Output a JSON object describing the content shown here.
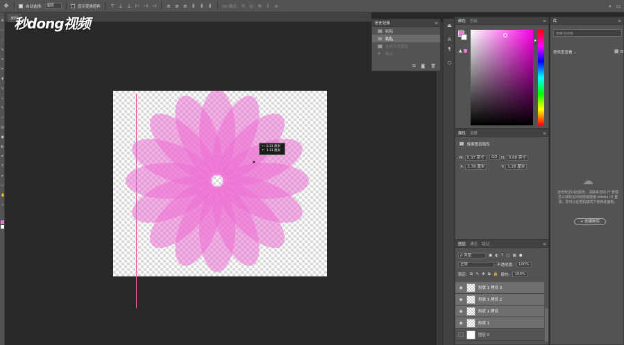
{
  "optbar": {
    "auto_select_label": "自动选择:",
    "auto_select_value": "图层",
    "show_transform_label": "显示变换控件",
    "mode_3d_label": "3D 模式:"
  },
  "doc_tab": {
    "title": "未标"
  },
  "watermark": "秒dong视频",
  "tooltip": {
    "line1": "←: 0.31 厘米",
    "line2": "↑: 1.11 厘米"
  },
  "history": {
    "title": "历史记录",
    "items": [
      {
        "label": "粘贴",
        "state": "normal"
      },
      {
        "label": "粘贴",
        "state": "selected"
      },
      {
        "label": "合并可见图层",
        "state": "disabled"
      },
      {
        "label": "移动",
        "state": "disabled"
      }
    ]
  },
  "color_panel": {
    "tab_color": "颜色",
    "tab_swatches": "色板",
    "fg": "#ec7ad0",
    "bg": "#ffffff"
  },
  "properties": {
    "tab_props": "属性",
    "tab_adjust": "调整",
    "section": "像素图层属性",
    "w_label": "W:",
    "w_value": "0.37 英寸",
    "link": "GO",
    "h_label": "H:",
    "h_value": "0.68 英寸",
    "x_label": "X:",
    "x_value": "1.39 厘米",
    "y_label": "Y:",
    "y_value": "1.28 厘米"
  },
  "layers": {
    "tab_layers": "图层",
    "tab_channels": "通道",
    "tab_paths": "路径",
    "filter": "ρ 类型",
    "blend": "正常",
    "opacity_label": "不透明度:",
    "opacity_value": "100%",
    "lock_label": "锁定:",
    "fill_label": "填充:",
    "fill_value": "100%",
    "items": [
      {
        "name": "形状 1 拷贝 3",
        "selected": true,
        "white": false
      },
      {
        "name": "形状 1 拷贝 2",
        "selected": true,
        "white": false
      },
      {
        "name": "形状 1 拷贝",
        "selected": true,
        "white": false
      },
      {
        "name": "形状 1",
        "selected": true,
        "white": false
      },
      {
        "name": "图层 0",
        "selected": false,
        "white": true
      }
    ]
  },
  "library": {
    "title": "库",
    "search_placeholder": "搜索当前库",
    "view_label": "按类型查看",
    "message": "您无权访问此服务，请联系您的 IT 管理员以获取访问权限或使用 Adobe ID 登录。您可以在脱机模式下使用此面板。",
    "create_button": "+ 创建新库"
  },
  "colors": {
    "accent_pink": "#ec7ad0",
    "panel_bg": "#535353",
    "workspace_bg": "#282828"
  }
}
